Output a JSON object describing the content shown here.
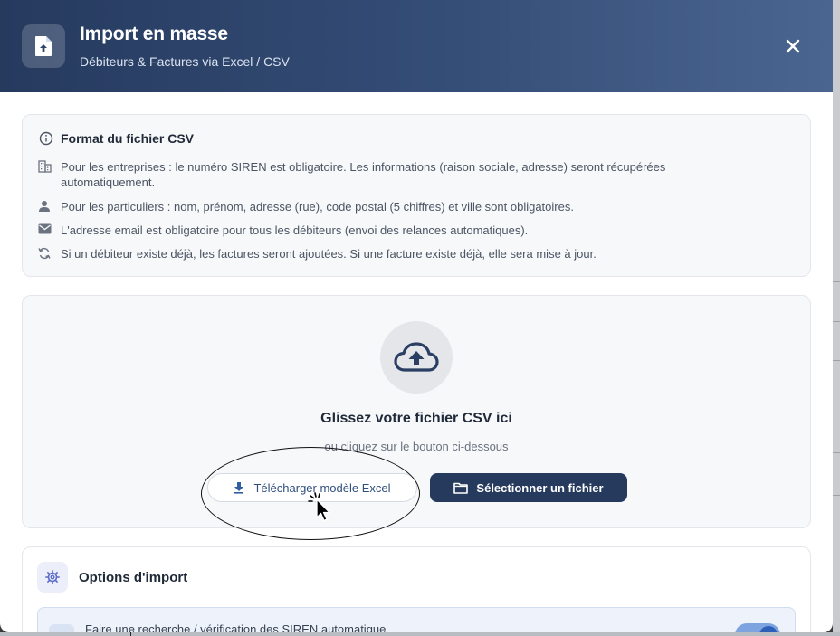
{
  "header": {
    "icon": "file-upload-icon",
    "title": "Import en masse",
    "subtitle": "Débiteurs & Factures via Excel / CSV",
    "close_icon": "close-icon"
  },
  "info": {
    "title": "Format du fichier CSV",
    "title_icon": "info-circle-icon",
    "rows": [
      {
        "icon": "building-icon",
        "text": "Pour les entreprises : le numéro SIREN est obligatoire. Les informations (raison sociale, adresse) seront récupérées automatiquement."
      },
      {
        "icon": "person-icon",
        "text": "Pour les particuliers : nom, prénom, adresse (rue), code postal (5 chiffres) et ville sont obligatoires."
      },
      {
        "icon": "mail-icon",
        "text": "L'adresse email est obligatoire pour tous les débiteurs (envoi des relances automatiques)."
      },
      {
        "icon": "sync-icon",
        "text": "Si un débiteur existe déjà, les factures seront ajoutées. Si une facture existe déjà, elle sera mise à jour."
      }
    ]
  },
  "dropzone": {
    "icon": "cloud-upload-icon",
    "title": "Glissez votre fichier CSV ici",
    "subtitle": "ou cliquez sur le bouton ci-dessous",
    "template_button": "Télécharger modèle Excel",
    "select_button": "Sélectionner un fichier"
  },
  "options": {
    "title": "Options d'import",
    "icon": "gear-icon",
    "siren_label": "Faire une recherche / vérification des SIREN automatique",
    "siren_enabled": true
  },
  "colors": {
    "header_dark": "#263a5e",
    "primary_button": "#263a5e",
    "link_text": "#2f4f7f",
    "toggle_on": "#2d5fb8"
  }
}
